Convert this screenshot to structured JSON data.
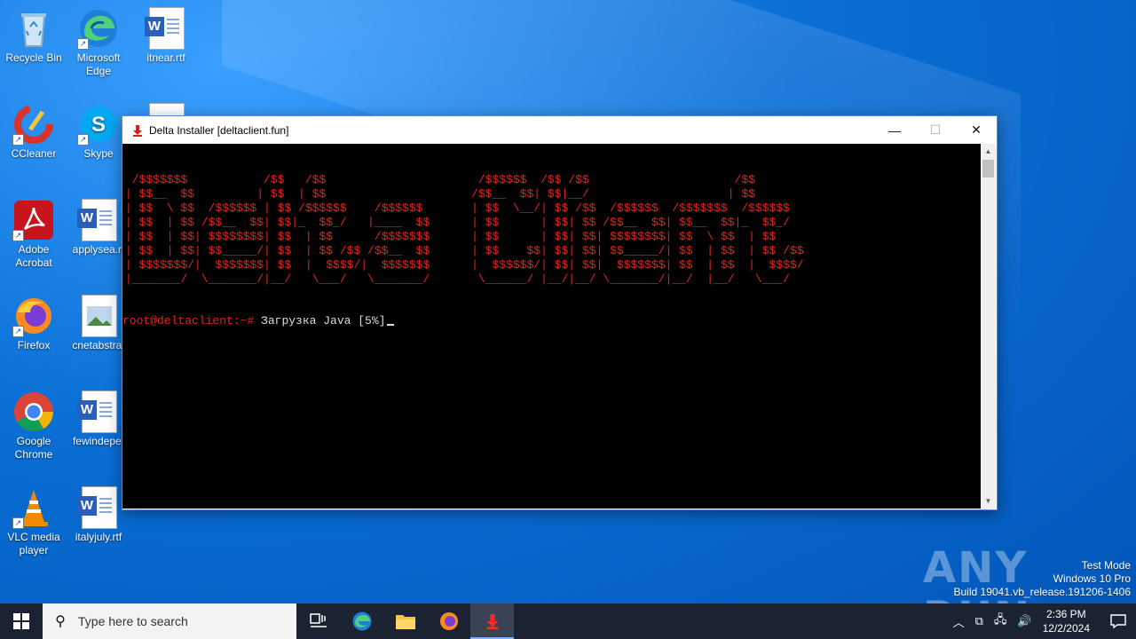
{
  "desktop": {
    "icons": [
      {
        "label": "Recycle Bin"
      },
      {
        "label": "Microsoft Edge"
      },
      {
        "label": "itnear.rtf"
      },
      {
        "label": "CCleaner"
      },
      {
        "label": "Skype"
      },
      {
        "label": "Adobe Acrobat"
      },
      {
        "label": "applysea.rt"
      },
      {
        "label": "Firefox"
      },
      {
        "label": "cnetabstra."
      },
      {
        "label": "Google Chrome"
      },
      {
        "label": "fewindepe."
      },
      {
        "label": "VLC media player"
      },
      {
        "label": "italyjuly.rtf"
      }
    ]
  },
  "window": {
    "title": "Delta Installer [deltaclient.fun]",
    "minimize": "—",
    "maximize": "☐",
    "close": "✕"
  },
  "console": {
    "ascii_art": " /$$$$$$$           /$$   /$$                      /$$$$$$  /$$ /$$                     /$$\n| $$__  $$         | $$  | $$                     /$$__  $$| $$|__/                    | $$\n| $$  \\ $$  /$$$$$$ | $$ /$$$$$$    /$$$$$$       | $$  \\__/| $$ /$$  /$$$$$$  /$$$$$$$  /$$$$$$\n| $$  | $$ /$$__  $$| $$|_  $$_/   |____  $$      | $$      | $$| $$ /$$__  $$| $$__  $$|_  $$_/\n| $$  | $$| $$$$$$$$| $$  | $$      /$$$$$$$      | $$      | $$| $$| $$$$$$$$| $$  \\ $$  | $$\n| $$  | $$| $$_____/| $$  | $$ /$$ /$$__  $$      | $$    $$| $$| $$| $$_____/| $$  | $$  | $$ /$$\n| $$$$$$$/|  $$$$$$$| $$  |  $$$$/|  $$$$$$$      |  $$$$$$/| $$| $$|  $$$$$$$| $$  | $$  |  $$$$/\n|_______/  \\_______/|__/   \\___/   \\_______/       \\______/ |__/|__/ \\_______/|__/  |__/   \\___/",
    "prompt_user": "root@deltaclient:~#",
    "prompt_text": " Загрузка Java [5%]"
  },
  "watermark": {
    "brand": "ANY RUN",
    "line1": "Test Mode",
    "line2": "Windows 10 Pro",
    "line3": "Build 19041.vb_release.191206-1406"
  },
  "taskbar": {
    "search_placeholder": "Type here to search",
    "time": "2:36 PM",
    "date": "12/2/2024"
  },
  "colors": {
    "console_red": "#e0261e",
    "taskbar_bg": "#1b2333"
  }
}
